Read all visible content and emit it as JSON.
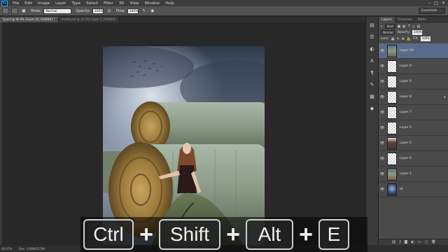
{
  "app": {
    "logo": "Ps",
    "menu": [
      "File",
      "Edit",
      "Image",
      "Layer",
      "Type",
      "Select",
      "Filter",
      "3D",
      "View",
      "Window",
      "Help"
    ],
    "window_controls": [
      "–",
      "□",
      "✕"
    ]
  },
  "options_bar": {
    "mode_label": "Mode:",
    "mode_value": "Normal",
    "opacity_label": "Opacity:",
    "opacity_value": "100%",
    "flow_label": "Flow:",
    "flow_value": "100%",
    "workspace": "Essentials"
  },
  "doc_tabs": [
    {
      "label": "ty.psd @ 66.9% (Layer 10, RGB/8#) *",
      "active": true
    },
    {
      "label": "model.psd @ 33.3% (Layer 1, RGB/8#)",
      "active": false
    }
  ],
  "status_bar": {
    "zoom": "66.67%",
    "doc_size": "Doc: 3.60M/25.5M"
  },
  "layers_panel": {
    "tabs": [
      "Layers",
      "Channels",
      "Paths"
    ],
    "kind_filter": "Kind",
    "blend_mode": "Normal",
    "opacity_label": "Opacity:",
    "opacity_value": "100%",
    "lock_label": "Lock:",
    "fill_label": "Fill:",
    "fill_value": "100%",
    "layers": [
      {
        "name": "Layer 10",
        "thumb": "photo",
        "selected": true
      },
      {
        "name": "Layer 9",
        "thumb": "empty",
        "selected": false
      },
      {
        "name": "Layer 4",
        "thumb": "empty",
        "selected": false
      },
      {
        "name": "Layer 8",
        "thumb": "empty",
        "selected": false
      },
      {
        "name": "Layer 7",
        "thumb": "empty",
        "selected": false
      },
      {
        "name": "Layer 5",
        "thumb": "empty",
        "selected": false
      },
      {
        "name": "Layer 2",
        "thumb": "girl",
        "selected": false
      },
      {
        "name": "Layer 6",
        "thumb": "empty",
        "selected": false
      },
      {
        "name": "Layer 1",
        "thumb": "photo",
        "selected": false
      },
      {
        "name": "sk",
        "thumb": "dark",
        "selected": false
      }
    ],
    "footer_icons": [
      "link-icon",
      "fx-icon",
      "mask-icon",
      "adjustment-icon",
      "folder-icon",
      "new-layer-icon",
      "trash-icon"
    ]
  },
  "shortcut_overlay": {
    "keys": [
      "Ctrl",
      "Shift",
      "Alt",
      "E"
    ],
    "separator": "+"
  },
  "colors": {
    "menubar_bg": "#3d3d3d",
    "optbar_bg": "#535353",
    "panel_bg": "#4a4a4a",
    "canvas_bg": "#282828",
    "selected_layer": "#5a6a8a"
  }
}
